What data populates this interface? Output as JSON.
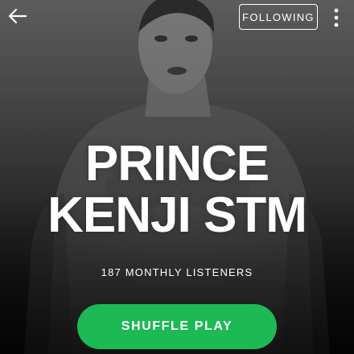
{
  "header": {
    "back_icon": "arrow-left-icon",
    "follow_label": "FOLLOWING",
    "more_icon": "vertical-dots-icon"
  },
  "artist": {
    "name_line1": "PRINCE",
    "name_line2": "KENJI STM",
    "monthly_listeners": "187 MONTHLY LISTENERS"
  },
  "actions": {
    "shuffle_label": "SHUFFLE PLAY"
  },
  "colors": {
    "accent": "#1db954",
    "text": "#ffffff"
  }
}
